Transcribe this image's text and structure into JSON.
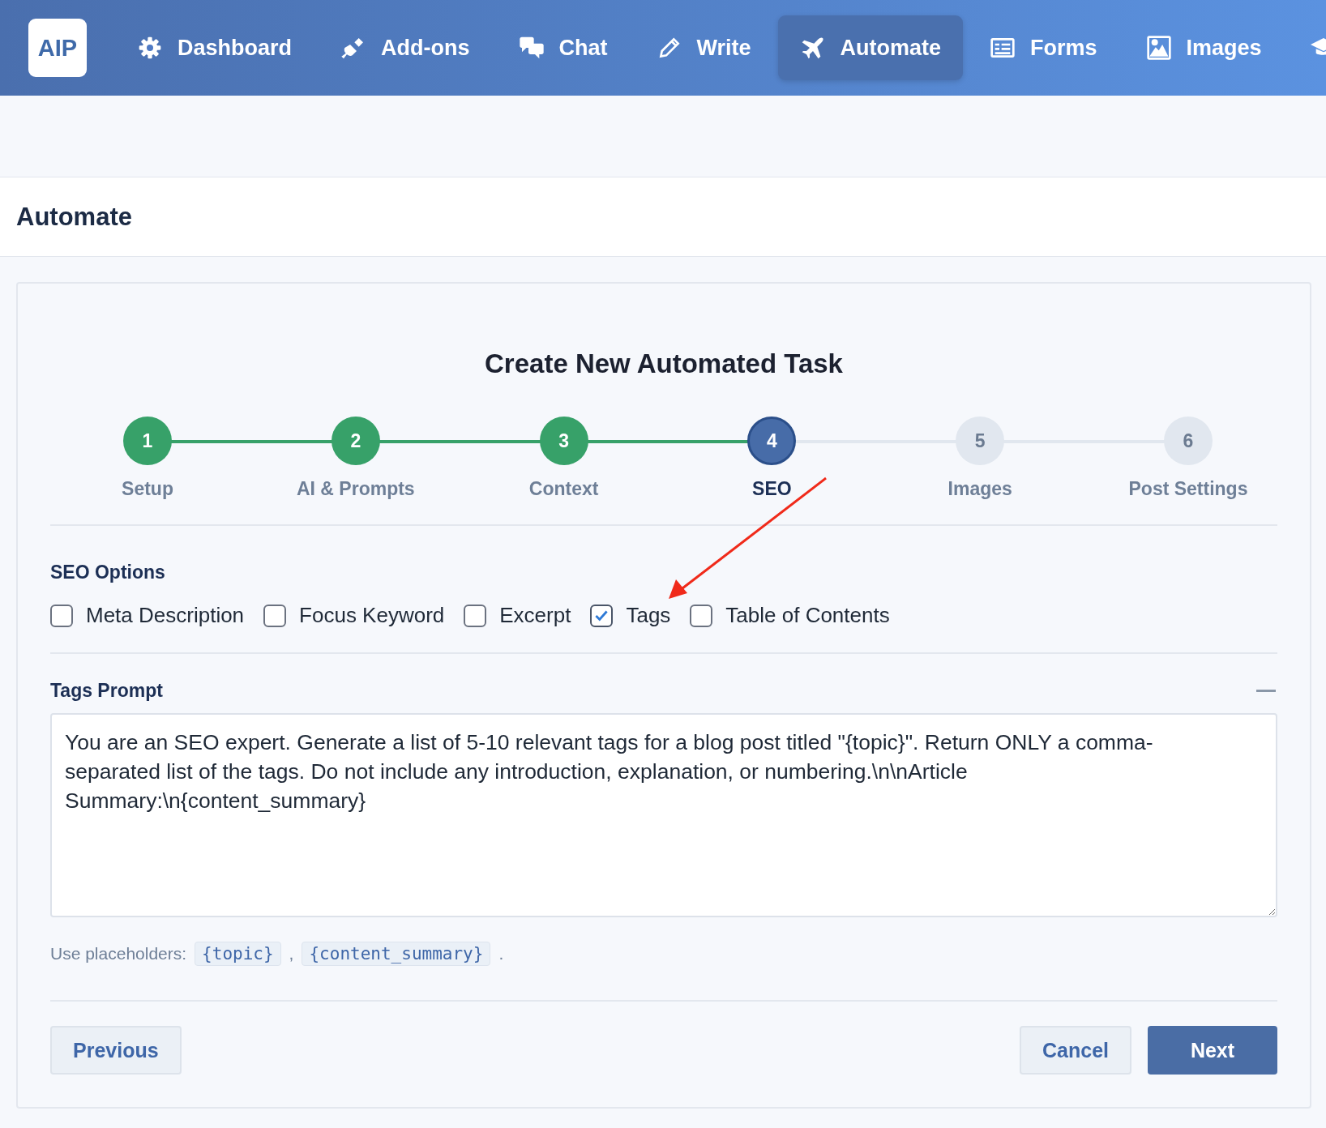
{
  "nav": {
    "logo": "AIP",
    "items": [
      {
        "label": "Dashboard",
        "kind": "gear",
        "selected": false
      },
      {
        "label": "Add-ons",
        "kind": "plug",
        "selected": false
      },
      {
        "label": "Chat",
        "kind": "chat",
        "selected": false
      },
      {
        "label": "Write",
        "kind": "pencil",
        "selected": false
      },
      {
        "label": "Automate",
        "kind": "plane",
        "selected": true
      },
      {
        "label": "Forms",
        "kind": "form",
        "selected": false
      },
      {
        "label": "Images",
        "kind": "image",
        "selected": false
      },
      {
        "kind": "cap",
        "selected": false
      }
    ]
  },
  "page_title": "Automate",
  "wizard": {
    "title": "Create New Automated Task",
    "steps": [
      {
        "number": "1",
        "label": "Setup",
        "kind": "done"
      },
      {
        "number": "2",
        "label": "AI & Prompts",
        "kind": "done"
      },
      {
        "number": "3",
        "label": "Context",
        "kind": "done"
      },
      {
        "number": "4",
        "label": "SEO",
        "kind": "current"
      },
      {
        "number": "5",
        "label": "Images",
        "kind": "upcoming"
      },
      {
        "number": "6",
        "label": "Post Settings",
        "kind": "upcoming"
      }
    ],
    "seo_options": {
      "heading": "SEO Options",
      "options": [
        {
          "label": "Meta Description",
          "checked": false
        },
        {
          "label": "Focus Keyword",
          "checked": false
        },
        {
          "label": "Excerpt",
          "checked": false
        },
        {
          "label": "Tags",
          "checked": true
        },
        {
          "label": "Table of Contents",
          "checked": false
        }
      ]
    },
    "prompt": {
      "heading": "Tags Prompt",
      "value": "You are an SEO expert. Generate a list of 5-10 relevant tags for a blog post titled \"{topic}\". Return ONLY a comma-separated list of the tags. Do not include any introduction, explanation, or numbering.\\n\\nArticle Summary:\\n{content_summary}"
    },
    "placeholders": {
      "label": "Use placeholders:",
      "codes": [
        "{topic}",
        "{content_summary}"
      ],
      "separator": ",",
      "end": "."
    },
    "buttons": {
      "previous": "Previous",
      "cancel": "Cancel",
      "next": "Next"
    }
  }
}
